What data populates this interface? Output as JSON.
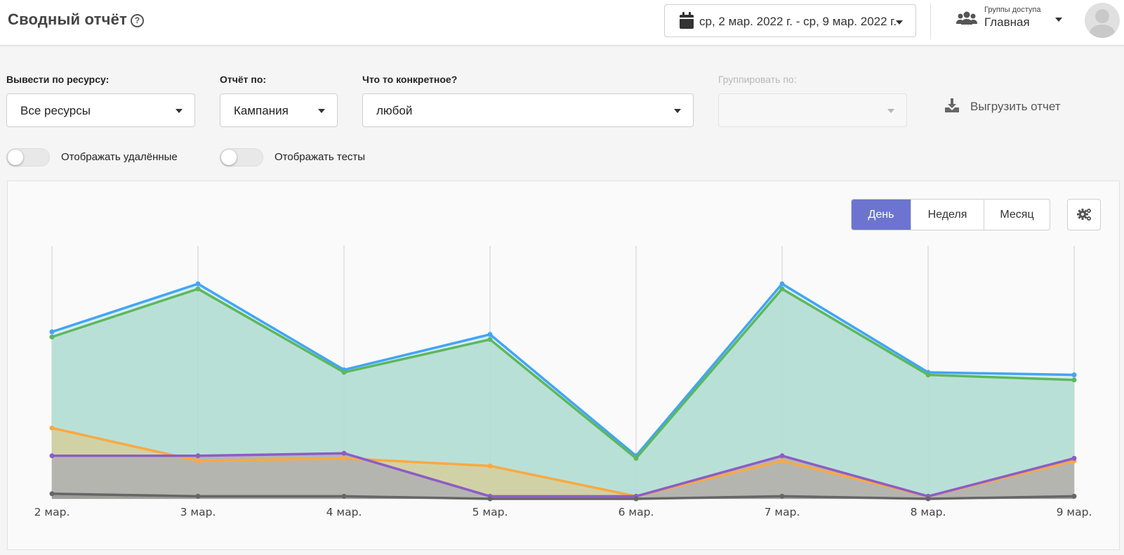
{
  "header": {
    "title": "Сводный отчёт",
    "help_icon": "question-circle-icon",
    "date_range": "ср, 2 мар. 2022 г. - ср, 9 мар. 2022 г.",
    "access_groups_label": "Группы доступа",
    "access_group_value": "Главная"
  },
  "filters": {
    "resource": {
      "label": "Вывести по ресурсу:",
      "value": "Все ресурсы"
    },
    "report_by": {
      "label": "Отчёт по:",
      "value": "Кампания"
    },
    "specific": {
      "label": "Что то конкретное?",
      "value": "любой"
    },
    "group_by": {
      "label": "Группировать по:",
      "value": ""
    },
    "export_label": "Выгрузить отчет"
  },
  "toggles": {
    "show_deleted": {
      "label": "Отображать удалённые",
      "on": false
    },
    "show_tests": {
      "label": "Отображать тесты",
      "on": false
    }
  },
  "period": {
    "options": [
      "День",
      "Неделя",
      "Месяц"
    ],
    "active": "День"
  },
  "colors": {
    "accent": "#6c74cf",
    "series_blue": "#42a5f5",
    "series_green": "#5cb85c",
    "series_orange": "#f9a942",
    "series_purple": "#8e5cc7",
    "series_dark": "#666666"
  },
  "chart_data": {
    "type": "area",
    "categories": [
      "2 мар.",
      "3 мар.",
      "4 мар.",
      "5 мар.",
      "6 мар.",
      "7 мар.",
      "8 мар.",
      "9 мар."
    ],
    "ylim": [
      0,
      100
    ],
    "grid": "vertical",
    "series": [
      {
        "values": [
          66,
          85,
          51,
          65,
          17,
          85,
          50,
          49
        ]
      },
      {
        "values": [
          64,
          83,
          50,
          63,
          16,
          83,
          49,
          47
        ]
      },
      {
        "values": [
          28,
          15,
          16,
          13,
          1,
          15,
          1,
          15
        ]
      },
      {
        "values": [
          17,
          17,
          18,
          1,
          1,
          17,
          1,
          16
        ]
      },
      {
        "values": [
          2,
          1,
          1,
          0,
          0,
          1,
          0,
          1
        ]
      }
    ]
  }
}
